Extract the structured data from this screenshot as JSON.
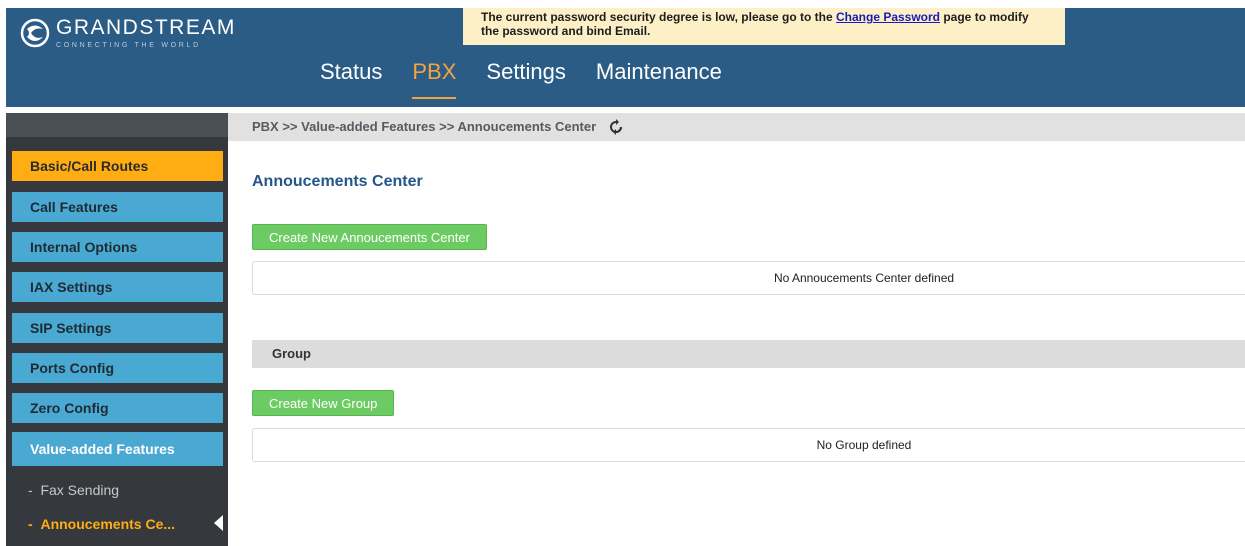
{
  "header": {
    "brand_name": "GRANDSTREAM",
    "brand_tagline": "CONNECTING THE WORLD",
    "alert_text_before": "The current password security degree is low, please go to the ",
    "alert_link": "Change Password",
    "alert_text_after": " page to modify the password and bind Email."
  },
  "nav": {
    "items": [
      {
        "label": "Status"
      },
      {
        "label": "PBX"
      },
      {
        "label": "Settings"
      },
      {
        "label": "Maintenance"
      }
    ],
    "active": "PBX"
  },
  "sidebar": {
    "items": [
      {
        "label": "Basic/Call Routes"
      },
      {
        "label": "Call Features"
      },
      {
        "label": "Internal Options"
      },
      {
        "label": "IAX Settings"
      },
      {
        "label": "SIP Settings"
      },
      {
        "label": "Ports Config"
      },
      {
        "label": "Zero Config"
      },
      {
        "label": "Value-added Features"
      }
    ],
    "subitems": [
      {
        "label": "Fax Sending"
      },
      {
        "label": "Annoucements Ce..."
      }
    ]
  },
  "breadcrumb": "PBX >> Value-added Features >> Annoucements Center",
  "main": {
    "title": "Annoucements Center",
    "create_center_button": "Create New Annoucements Center",
    "empty_center": "No Annoucements Center defined",
    "group_section": "Group",
    "create_group_button": "Create New Group",
    "empty_group": "No Group defined"
  },
  "colors": {
    "header": "#2b5c85",
    "accent_orange": "#ffad12",
    "sidebar_blue": "#4aa9d3",
    "button_green": "#6ccc63",
    "title_blue": "#24568a"
  }
}
